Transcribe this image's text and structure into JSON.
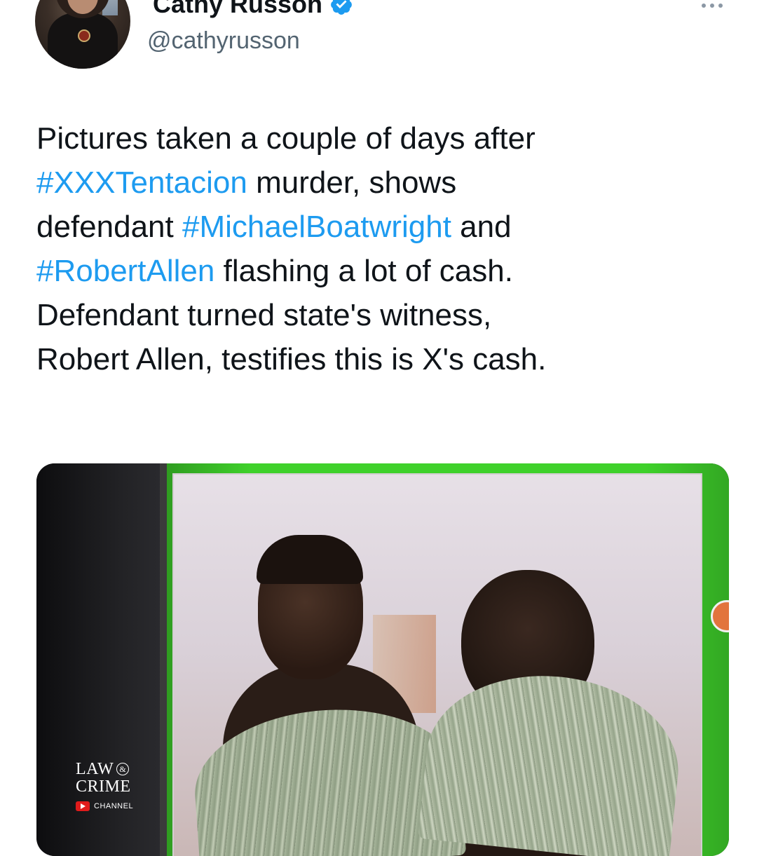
{
  "tweet": {
    "display_name": "Cathy Russon",
    "handle": "@cathyrusson",
    "text_lines": [
      [
        {
          "t": "Pictures taken a couple of days after",
          "tag": false
        }
      ],
      [
        {
          "t": "#XXXTentacion",
          "tag": true
        },
        {
          "t": " murder, shows",
          "tag": false
        }
      ],
      [
        {
          "t": "defendant ",
          "tag": false
        },
        {
          "t": "#MichaelBoatwright",
          "tag": true
        },
        {
          "t": " and",
          "tag": false
        }
      ],
      [
        {
          "t": "#RobertAllen",
          "tag": true
        },
        {
          "t": " flashing a lot of cash.",
          "tag": false
        }
      ],
      [
        {
          "t": "Defendant turned state's witness,",
          "tag": false
        }
      ],
      [
        {
          "t": "Robert Allen, testifies this is X's cash.",
          "tag": false
        }
      ]
    ]
  },
  "media": {
    "logo": {
      "line1": "LAW",
      "amp": "&",
      "line2": "CRIME",
      "channel": "CHANNEL"
    }
  },
  "colors": {
    "hashtag": "#1d9bf0",
    "verified": "#1d9bf0",
    "handle": "#536471"
  },
  "icons": {
    "verified": "verified-badge-icon",
    "more": "more-options-icon",
    "play": "youtube-play-icon"
  }
}
